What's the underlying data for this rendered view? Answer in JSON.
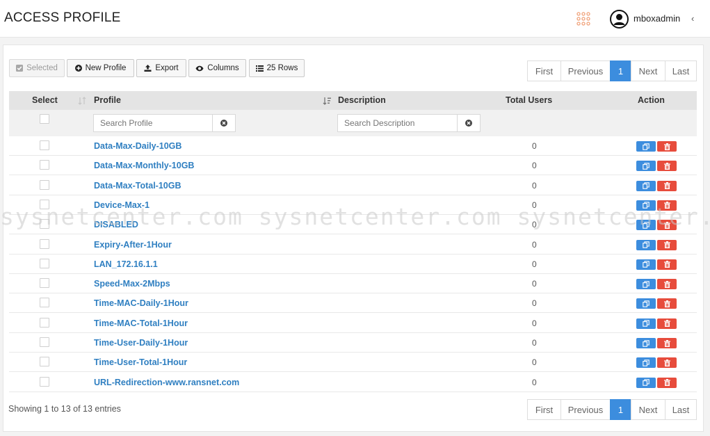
{
  "header": {
    "title": "ACCESS PROFILE",
    "username": "mboxadmin",
    "apps_icon": "grid-dots-icon",
    "avatar_icon": "user-circle-icon",
    "collapse_icon": "chevron-left-icon",
    "apps_icon_color": "#f0a27a"
  },
  "toolbar": {
    "selected_label": "Selected",
    "new_profile_label": "New Profile",
    "export_label": "Export",
    "columns_label": "Columns",
    "rows_label": "25 Rows"
  },
  "pagination": {
    "first": "First",
    "previous": "Previous",
    "current": "1",
    "next": "Next",
    "last": "Last",
    "accent": "#3c8dde"
  },
  "table": {
    "columns": {
      "select": "Select",
      "profile": "Profile",
      "description": "Description",
      "total_users": "Total Users",
      "action": "Action"
    },
    "filters": {
      "profile_placeholder": "Search Profile",
      "description_placeholder": "Search Description"
    },
    "rows": [
      {
        "profile": "Data-Max-Daily-10GB",
        "description": "",
        "total_users": "0"
      },
      {
        "profile": "Data-Max-Monthly-10GB",
        "description": "",
        "total_users": "0"
      },
      {
        "profile": "Data-Max-Total-10GB",
        "description": "",
        "total_users": "0"
      },
      {
        "profile": "Device-Max-1",
        "description": "",
        "total_users": "0"
      },
      {
        "profile": "DISABLED",
        "description": "",
        "total_users": "0"
      },
      {
        "profile": "Expiry-After-1Hour",
        "description": "",
        "total_users": "0"
      },
      {
        "profile": "LAN_172.16.1.1",
        "description": "",
        "total_users": "0"
      },
      {
        "profile": "Speed-Max-2Mbps",
        "description": "",
        "total_users": "0"
      },
      {
        "profile": "Time-MAC-Daily-1Hour",
        "description": "",
        "total_users": "0"
      },
      {
        "profile": "Time-MAC-Total-1Hour",
        "description": "",
        "total_users": "0"
      },
      {
        "profile": "Time-User-Daily-1Hour",
        "description": "",
        "total_users": "0"
      },
      {
        "profile": "Time-User-Total-1Hour",
        "description": "",
        "total_users": "0"
      },
      {
        "profile": "URL-Redirection-www.ransnet.com",
        "description": "",
        "total_users": "0"
      }
    ],
    "action_icons": [
      "copy-icon",
      "trash-icon"
    ],
    "copy_color": "#3c8dde",
    "delete_color": "#e74c3c"
  },
  "footer": {
    "entries_text": "Showing 1 to 13 of 13 entries"
  },
  "watermark": {
    "text": "sysnetcenter.com sysnetcenter.com sysnetcenter.com"
  }
}
